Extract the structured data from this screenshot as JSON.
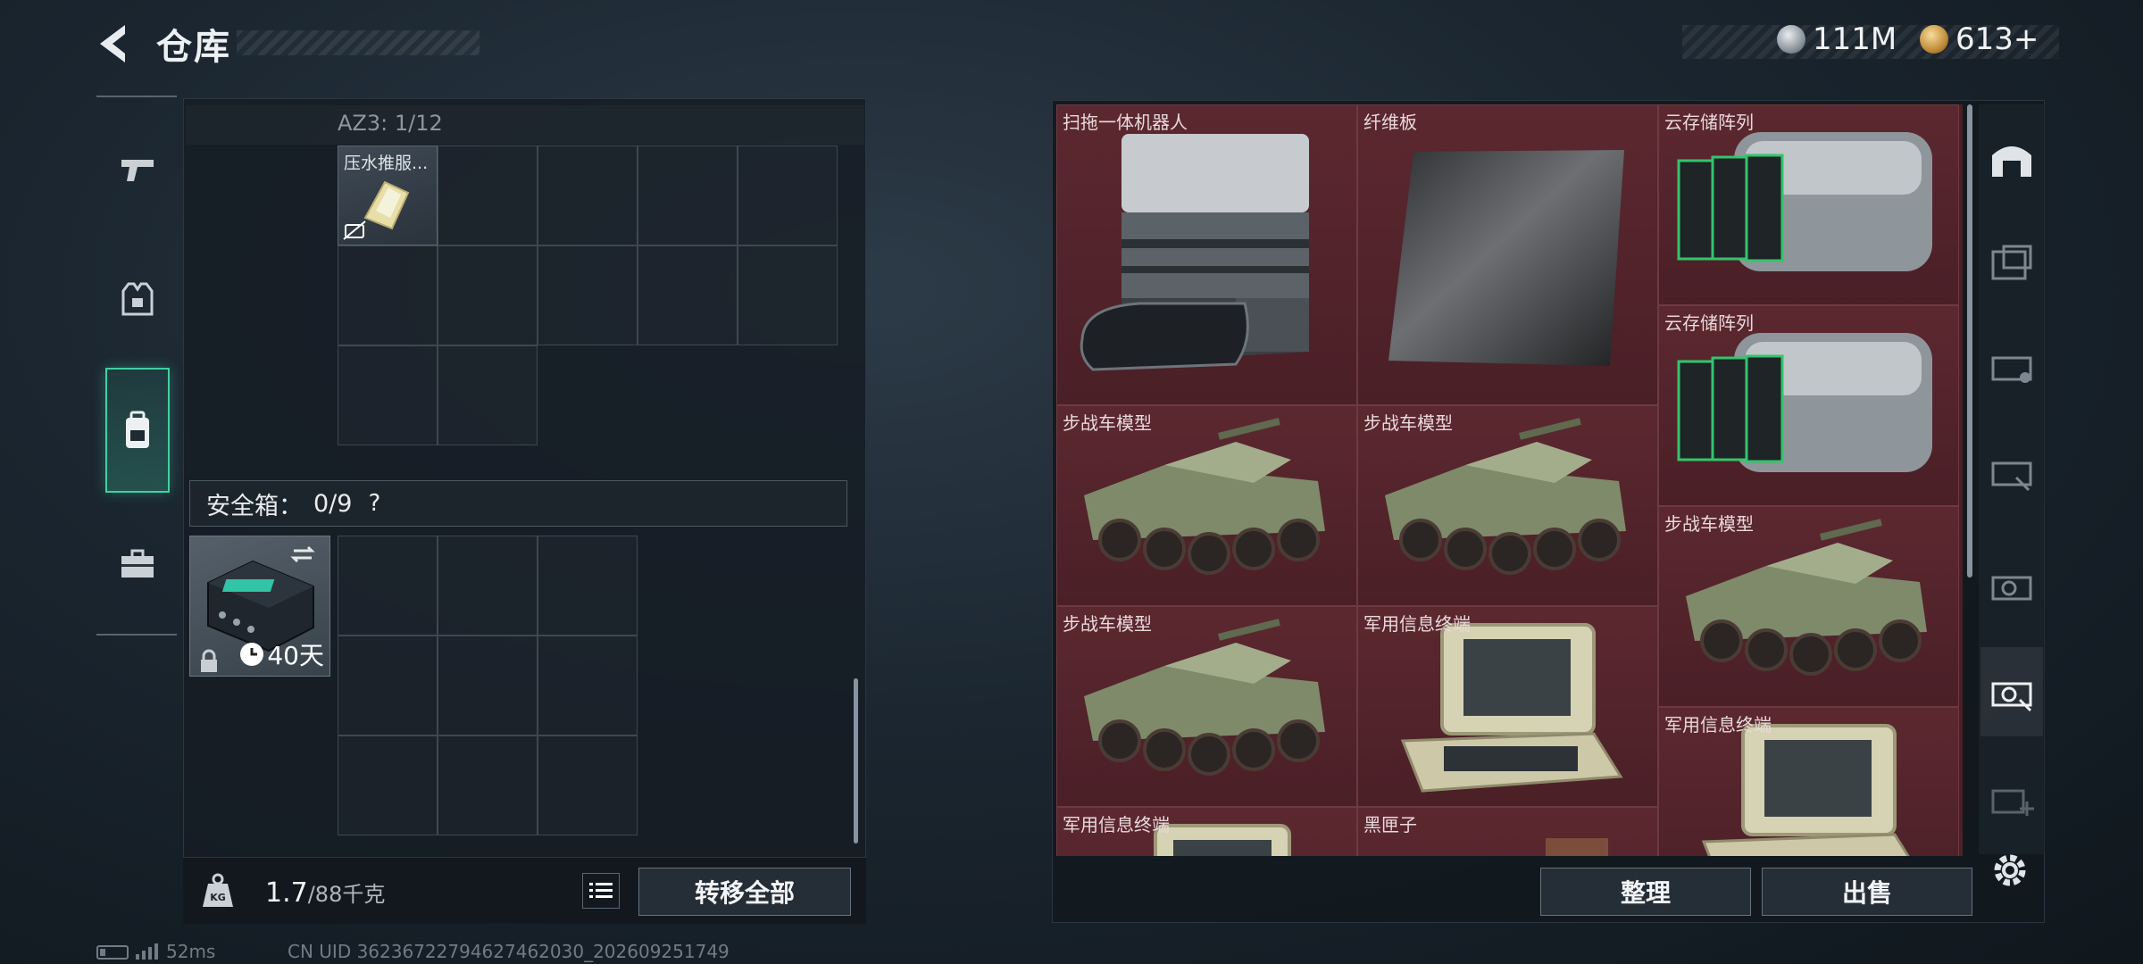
{
  "header": {
    "title": "仓库",
    "currency_silver": "111M",
    "currency_gold": "613+"
  },
  "left": {
    "container_label": "AZ3: 1/12",
    "item_pressure_name": "压水推服...",
    "safe_box_label": "安全箱：",
    "safe_box_count": "0/9",
    "safe_box_help": "?",
    "case_timer": "40天",
    "weight_current": "1.7",
    "weight_max": "/88千克",
    "transfer_all": "转移全部"
  },
  "right": {
    "items": [
      {
        "name": "扫拖一体机器人",
        "icon": "robot-vacuum-icon"
      },
      {
        "name": "纤维板",
        "icon": "fiber-board-icon"
      },
      {
        "name": "云存储阵列",
        "icon": "cloud-storage-array-icon"
      },
      {
        "name": "云存储阵列",
        "icon": "cloud-storage-array-icon"
      },
      {
        "name": "步战车模型",
        "icon": "ifv-model-icon"
      },
      {
        "name": "步战车模型",
        "icon": "ifv-model-icon"
      },
      {
        "name": "步战车模型",
        "icon": "ifv-model-icon"
      },
      {
        "name": "步战车模型",
        "icon": "ifv-model-icon"
      },
      {
        "name": "军用信息终端",
        "icon": "military-terminal-icon"
      },
      {
        "name": "军用信息终端",
        "icon": "military-terminal-icon"
      },
      {
        "name": "军用信息终端",
        "icon": "military-terminal-icon"
      },
      {
        "name": "黑匣子",
        "icon": "black-box-icon"
      }
    ],
    "tidy": "整理",
    "sell": "出售"
  },
  "status": {
    "ping": "52ms",
    "uid": "CN UID 36236722794627462030_202609251749"
  },
  "colors": {
    "accent_green": "#3fd1a3",
    "item_bg_red": "#4a1f26",
    "panel_bg": "#161d24"
  }
}
